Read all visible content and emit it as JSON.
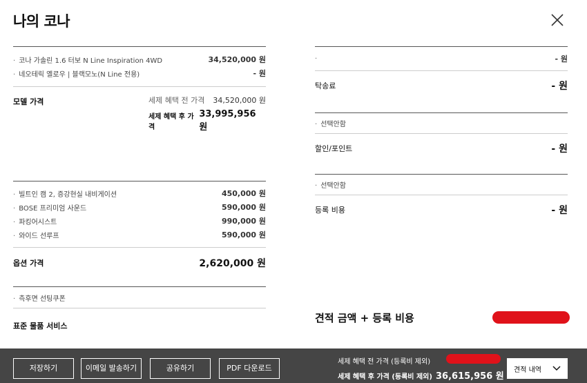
{
  "header": {
    "title": "나의 코나"
  },
  "left": {
    "trim_items": [
      {
        "label": "코나 가솔린 1.6 터보 N Line Inspiration 4WD",
        "value": "34,520,000 원"
      },
      {
        "label": "네오테릭 옐로우 | 블랙모노(N Line 전용)",
        "value": "- 원"
      }
    ],
    "model_price": {
      "label": "모델 가격",
      "before_label": "세제 혜택 전 가격",
      "before_value": "34,520,000 원",
      "after_label": "세제 혜택 후 가격",
      "after_value": "33,995,956 원"
    },
    "options": [
      {
        "label": "빌트인 캠 2, 증강현실 내비게이션",
        "value": "450,000 원"
      },
      {
        "label": "BOSE 프리미엄 사운드",
        "value": "590,000 원"
      },
      {
        "label": "파킹어시스트",
        "value": "990,000 원"
      },
      {
        "label": "와이드 선루프",
        "value": "590,000 원"
      }
    ],
    "option_price": {
      "label": "옵션 가격",
      "value": "2,620,000 원"
    },
    "coupon": "측후면 선팅쿠폰",
    "standard_service": "표준 물품 서비스"
  },
  "right": {
    "first_value": "- 원",
    "consignment": {
      "label": "탁송료",
      "value": "- 원"
    },
    "select_note_1": "선택안함",
    "discount": {
      "label": "할인/포인트",
      "value": "- 원"
    },
    "select_note_2": "선택안함",
    "registration": {
      "label": "등록 비용",
      "value": "- 원"
    },
    "estimate_label": "견적 금액 + 등록 비용"
  },
  "footer": {
    "buttons": [
      "저장하기",
      "이메일 발송하기",
      "공유하기",
      "PDF 다운로드"
    ],
    "before_label": "세제 혜택 전 가격 (등록비 제외)",
    "after_label": "세제 혜택 후 가격 (등록비 제외)",
    "after_value": "36,615,956 원",
    "dropdown": "견적 내역"
  },
  "colors": {
    "footer_bg": "#454545",
    "redaction": "#e0121a"
  }
}
